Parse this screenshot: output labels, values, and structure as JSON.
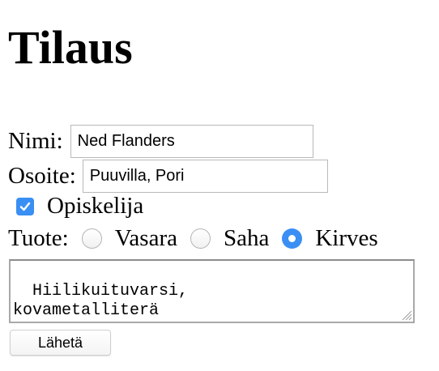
{
  "page": {
    "title": "Tilaus"
  },
  "form": {
    "name": {
      "label": "Nimi:",
      "value": "Ned Flanders"
    },
    "address": {
      "label": "Osoite:",
      "value": "Puuvilla, Pori"
    },
    "student": {
      "label": "Opiskelija",
      "checked": true
    },
    "product": {
      "label": "Tuote:",
      "options": [
        {
          "label": "Vasara",
          "checked": false
        },
        {
          "label": "Saha",
          "checked": false
        },
        {
          "label": "Kirves",
          "checked": true
        }
      ]
    },
    "notes": {
      "value": "Hiilikuituvarsi,\nkovametalliterä"
    },
    "submit_label": "Lähetä"
  },
  "colors": {
    "accent": "#3a8ff4",
    "input_border": "#b9b9b9"
  },
  "icons": {
    "checkbox": "checkmark-icon",
    "resize": "resize-grip-icon"
  }
}
